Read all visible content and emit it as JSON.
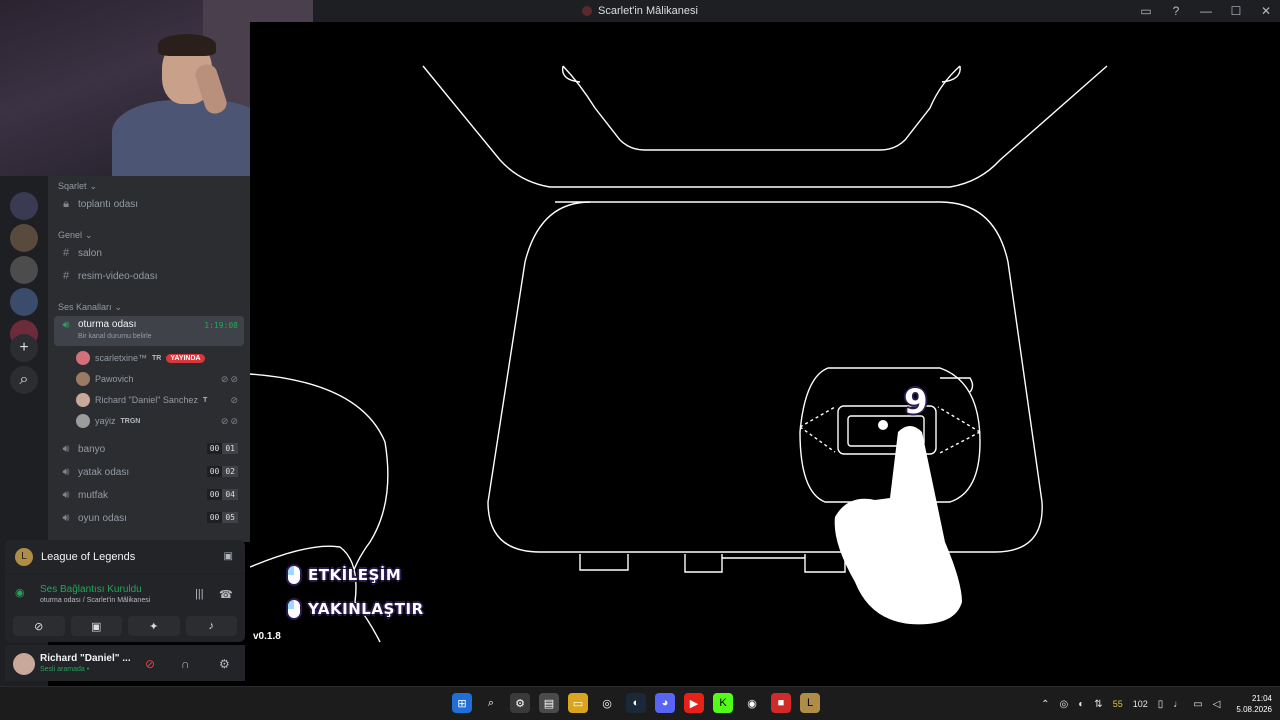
{
  "window": {
    "title": "Scarlet'in Mâlikanesi",
    "controls": {
      "inbox": "▭",
      "help": "?",
      "minimize": "—",
      "maximize": "☐",
      "close": "✕"
    }
  },
  "rail": {
    "add_label": "+",
    "discover_label": "⌕"
  },
  "channels": {
    "categories": [
      {
        "name": "Sqarlet",
        "chevron": "⌄"
      },
      {
        "name": "Genel",
        "chevron": "⌄"
      },
      {
        "name": "Ses Kanalları",
        "chevron": "⌄"
      }
    ],
    "text_channels": [
      {
        "name": "toplantı odası",
        "icon": "lock-icon"
      },
      {
        "name": "salon",
        "icon": "hash-icon"
      },
      {
        "name": "resim-video-odası",
        "icon": "hash-icon"
      }
    ],
    "active_voice": {
      "name": "oturma odası",
      "timer": "1:19:08",
      "status_hint": "Bir kanal durumu belirle"
    },
    "voice_users": [
      {
        "name": "scarletxine™",
        "tag": "TR",
        "badge": "YAYINDA",
        "color": "#d4707a"
      },
      {
        "name": "Pawovich",
        "tag": "",
        "badge": "",
        "color": "#9a7a62"
      },
      {
        "name": "Richard \"Daniel\" Sanchez",
        "tag": "T",
        "badge": "",
        "color": "#c8a89b"
      },
      {
        "name": "yaýiz",
        "tag": "TRGN",
        "badge": "",
        "color": "#9c9c9c"
      }
    ],
    "voice_channels": [
      {
        "name": "banyo",
        "count_a": "00",
        "count_b": "01"
      },
      {
        "name": "yatak odası",
        "count_a": "00",
        "count_b": "02"
      },
      {
        "name": "mutfak",
        "count_a": "00",
        "count_b": "04"
      },
      {
        "name": "oyun odası",
        "count_a": "00",
        "count_b": "05"
      }
    ]
  },
  "activity": {
    "game": "League of Legends",
    "voice_status": "Ses Bağlantısı Kuruldu",
    "voice_channel": "oturma odası / Scarlet'in Mâlikanesi"
  },
  "user": {
    "name": "Richard \"Daniel\" ...",
    "status": "Sesli aramada •"
  },
  "game_ui": {
    "hint_interact": "ETKİLEŞİM",
    "hint_zoom": "YAKINLAŞTIR",
    "version": "v0.1.8",
    "number": "9"
  },
  "taskbar": {
    "network_up": "55",
    "network_down": "102",
    "time": "21:04",
    "date": "5.08.2026"
  }
}
